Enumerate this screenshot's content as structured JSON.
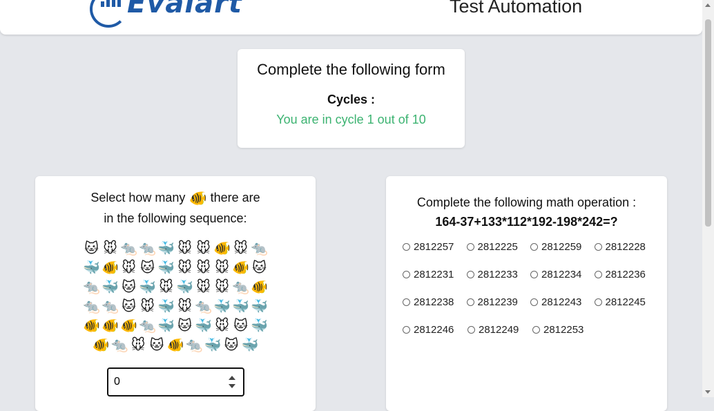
{
  "header": {
    "logo_text": "Evalart",
    "title": "Test Automation",
    "brand_color": "#1f5aa6"
  },
  "form_card": {
    "heading": "Complete the following form",
    "cycles_label": "Cycles :",
    "cycle_status": "You are in cycle 1 out of 10",
    "status_color": "#3cb371"
  },
  "count_card": {
    "question_pre": "Select how many",
    "target_emoji": "🐠",
    "question_post": "there are",
    "question_line2": "in the following sequence:",
    "grid": [
      [
        "🐱",
        "🐭",
        "🐀",
        "🐀",
        "🐳",
        "🐭",
        "🐭",
        "🐠",
        "🐭",
        "🐀"
      ],
      [
        "🐳",
        "🐠",
        "🐭",
        "🐱",
        "🐳",
        "🐭",
        "🐭",
        "🐭",
        "🐠",
        "🐱"
      ],
      [
        "🐀",
        "🐳",
        "🐱",
        "🐳",
        "🐭",
        "🐳",
        "🐭",
        "🐭",
        "🐀",
        "🐠"
      ],
      [
        "🐀",
        "🐀",
        "🐱",
        "🐭",
        "🐳",
        "🐭",
        "🐀",
        "🐳",
        "🐳",
        "🐳"
      ],
      [
        "🐠",
        "🐠",
        "🐠",
        "🐀",
        "🐳",
        "🐱",
        "🐳",
        "🐭",
        "🐱",
        "🐳"
      ],
      [
        "🐠",
        "🐀",
        "🐭",
        "🐱",
        "🐠",
        "🐀",
        "🐳",
        "🐱",
        "🐳"
      ]
    ],
    "input_value": "0"
  },
  "math_card": {
    "question": "Complete the following math operation :",
    "expression": "164-37+133*112*192-198*242=?",
    "options": [
      [
        "2812257",
        "2812225",
        "2812259",
        "2812228"
      ],
      [
        "2812231",
        "2812233",
        "2812234",
        "2812236"
      ],
      [
        "2812238",
        "2812239",
        "2812243",
        "2812245"
      ],
      [
        "2812246",
        "2812249",
        "2812253"
      ]
    ]
  }
}
